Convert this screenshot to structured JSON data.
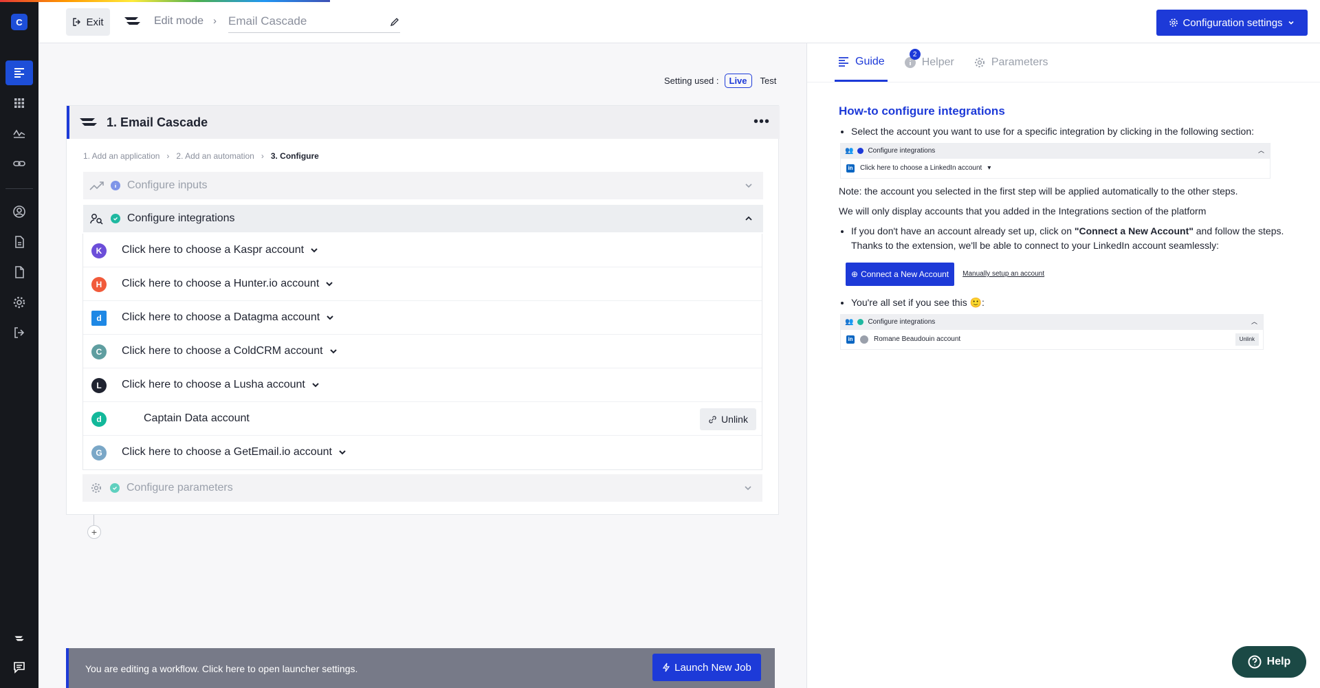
{
  "app": {
    "logo_letter": "C"
  },
  "progress": {
    "fraction": 0.25
  },
  "topbar": {
    "exit_label": "Exit",
    "edit_mode_label": "Edit mode",
    "crumb_separator": "›",
    "title_placeholder": "Email Cascade",
    "config_button_label": "Configuration settings"
  },
  "settings": {
    "label": "Setting used :",
    "live": "Live",
    "test": "Test"
  },
  "workflow": {
    "title": "1. Email Cascade",
    "menu": "•••",
    "steps": [
      "1. Add an application",
      "2. Add an automation",
      "3. Configure"
    ],
    "sections": {
      "inputs": "Configure inputs",
      "integrations": "Configure integrations",
      "parameters": "Configure parameters"
    },
    "integrations": [
      {
        "name": "kaspr",
        "label": "Click here to choose a Kaspr account",
        "color": "#6c4ed9",
        "glyph": "K"
      },
      {
        "name": "hunter",
        "label": "Click here to choose a Hunter.io account",
        "color": "#f15a3a",
        "glyph": "H"
      },
      {
        "name": "datagma",
        "label": "Click here to choose a Datagma account",
        "color": "#1e88e5",
        "glyph": "d"
      },
      {
        "name": "coldcrm",
        "label": "Click here to choose a ColdCRM account",
        "color": "#5f9ea0",
        "glyph": "C"
      },
      {
        "name": "lusha",
        "label": "Click here to choose a Lusha account",
        "color": "#1f2330",
        "glyph": "L"
      }
    ],
    "linked": {
      "label": "Captain Data account",
      "unlink": "Unlink",
      "color": "#12b89a",
      "glyph": "d"
    },
    "getemail": {
      "label": "Click here to choose a GetEmail.io account",
      "color": "#7aa7c7",
      "glyph": "G"
    },
    "add": "+"
  },
  "banner": {
    "text": "You are editing a workflow. Click here to open launcher settings.",
    "launch_label": "Launch New Job"
  },
  "panel": {
    "tabs": {
      "guide": "Guide",
      "helper": "Helper",
      "helper_badge": "2",
      "parameters": "Parameters"
    },
    "guide": {
      "heading": "How-to configure integrations",
      "bullet1": "Select the account you want to use for a specific integration by clicking in the following section:",
      "mini1_head": "Configure integrations",
      "mini1_row": "Click here to choose a LinkedIn account",
      "note1": "Note: the account you selected in the first step will be applied automatically to the other steps.",
      "note2": "We will only display accounts that you added in the Integrations section of the platform",
      "bullet2_pre": "If you don't have an account already set up, click on ",
      "bullet2_bold": "\"Connect a New Account\"",
      "bullet2_post": " and follow the steps. Thanks to the extension, we'll be able to connect to your LinkedIn account seamlessly:",
      "connect_label": "Connect a New Account",
      "manual_label": "Manually setup an account",
      "bullet3": "You're all set if you see this 🙂:",
      "mini2_head": "Configure integrations",
      "mini2_row": "Romane Beaudouin account",
      "mini2_unlink": "Unlink",
      "li_glyph": "in"
    }
  },
  "help_label": "Help",
  "colors": {
    "accent": "#1d3ad8",
    "sidebar": "#16181d",
    "help": "#1b4945"
  }
}
